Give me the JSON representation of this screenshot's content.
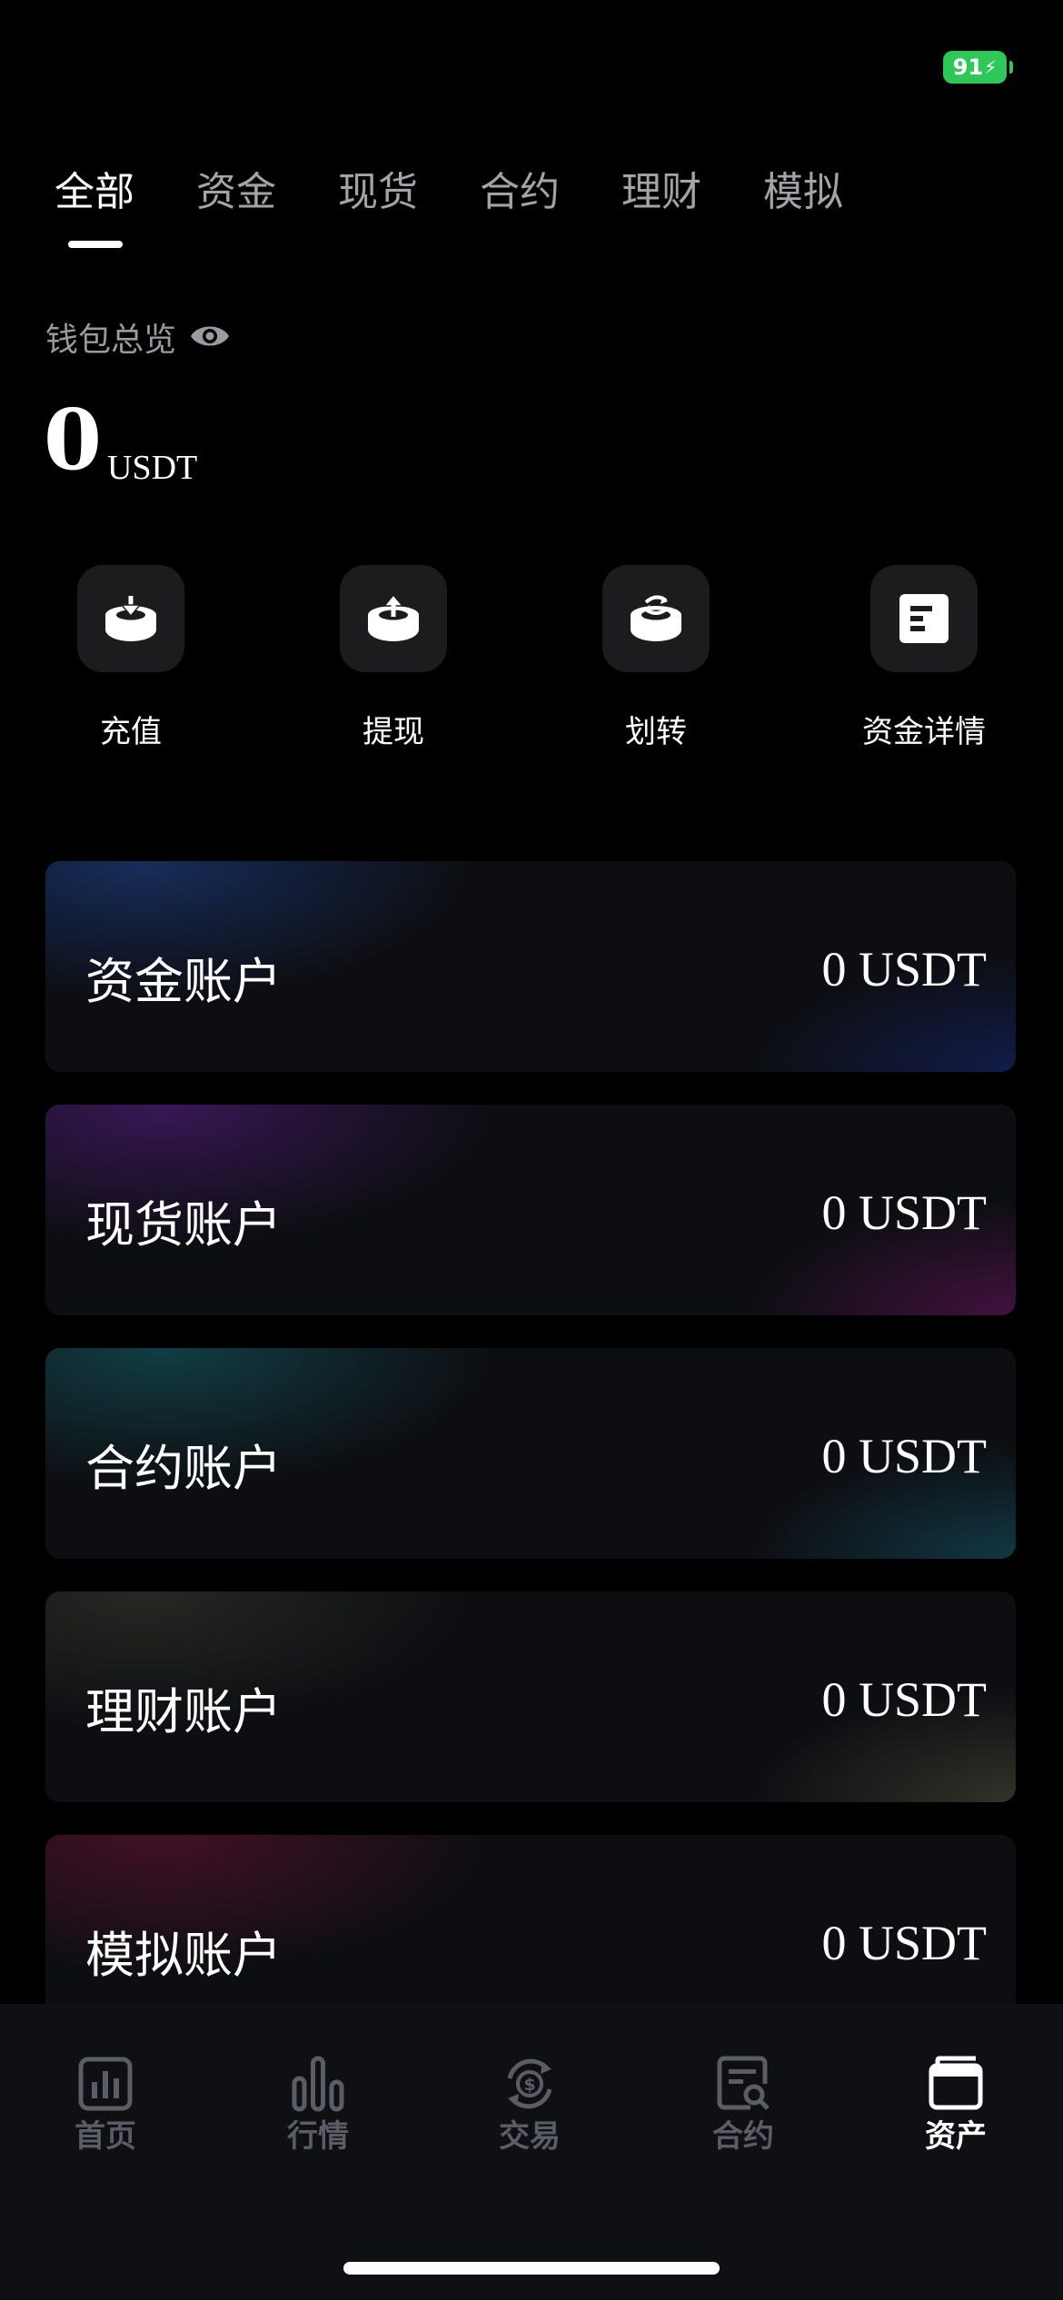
{
  "status_bar": {
    "battery": "91"
  },
  "tabs": [
    {
      "label": "全部",
      "active": true
    },
    {
      "label": "资金",
      "active": false
    },
    {
      "label": "现货",
      "active": false
    },
    {
      "label": "合约",
      "active": false
    },
    {
      "label": "理财",
      "active": false
    },
    {
      "label": "模拟",
      "active": false
    }
  ],
  "overview": {
    "label": "钱包总览",
    "total_value": "0",
    "unit": "USDT"
  },
  "actions": [
    {
      "label": "充值",
      "icon": "deposit-icon"
    },
    {
      "label": "提现",
      "icon": "withdraw-icon"
    },
    {
      "label": "划转",
      "icon": "transfer-icon"
    },
    {
      "label": "资金详情",
      "icon": "details-icon"
    }
  ],
  "accounts": [
    {
      "name": "资金账户",
      "value": "0 USDT"
    },
    {
      "name": "现货账户",
      "value": "0 USDT"
    },
    {
      "name": "合约账户",
      "value": "0 USDT"
    },
    {
      "name": "理财账户",
      "value": "0 USDT"
    },
    {
      "name": "模拟账户",
      "value": "0 USDT"
    }
  ],
  "bottom_nav": [
    {
      "label": "首页",
      "icon": "home-chart-icon",
      "active": false
    },
    {
      "label": "行情",
      "icon": "bar-chart-icon",
      "active": false
    },
    {
      "label": "交易",
      "icon": "dollar-exchange-icon",
      "active": false
    },
    {
      "label": "合约",
      "icon": "contract-search-icon",
      "active": false
    },
    {
      "label": "资产",
      "icon": "wallet-icon",
      "active": true
    }
  ],
  "colors": {
    "background": "#000000",
    "battery": "#30c75a",
    "nav_inactive": "#5b5d66",
    "nav_background": "#0f1014"
  }
}
